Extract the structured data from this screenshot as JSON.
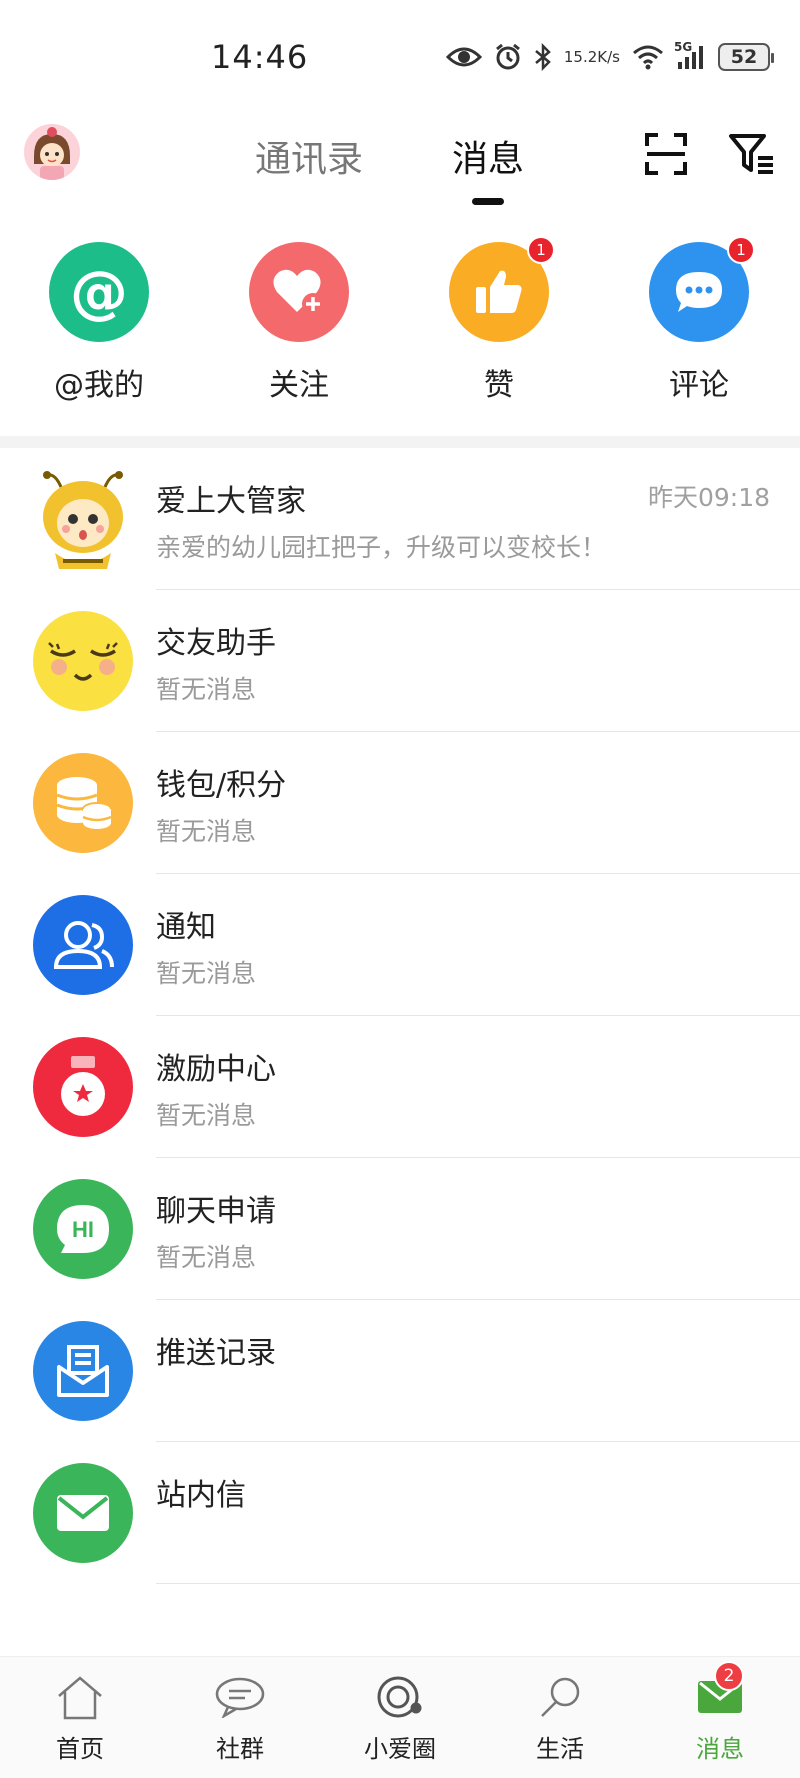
{
  "status_bar": {
    "time": "14:46",
    "net_speed_value": "15.2",
    "net_speed_unit": "K/s",
    "network": "5G",
    "battery": "52"
  },
  "header": {
    "tabs": [
      {
        "label": "通讯录",
        "active": false
      },
      {
        "label": "消息",
        "active": true
      }
    ]
  },
  "quick_actions": [
    {
      "label": "@我的",
      "icon": "at-icon",
      "color": "#1dbd8a",
      "badge": null
    },
    {
      "label": "关注",
      "icon": "heart-plus-icon",
      "color": "#f4696c",
      "badge": null
    },
    {
      "label": "赞",
      "icon": "thumbs-up-icon",
      "color": "#f9ac24",
      "badge": "1"
    },
    {
      "label": "评论",
      "icon": "chat-bubble-icon",
      "color": "#2d93ee",
      "badge": "1"
    }
  ],
  "messages": [
    {
      "title": "爱上大管家",
      "preview": "亲爱的幼儿园扛把子，升级可以变校长！",
      "time": "昨天09:18",
      "icon": "bee-mascot-icon"
    },
    {
      "title": "交友助手",
      "preview": "暂无消息",
      "time": "",
      "icon": "smiley-face-icon"
    },
    {
      "title": "钱包/积分",
      "preview": "暂无消息",
      "time": "",
      "icon": "coins-icon"
    },
    {
      "title": "通知",
      "preview": "暂无消息",
      "time": "",
      "icon": "users-icon"
    },
    {
      "title": "激励中心",
      "preview": "暂无消息",
      "time": "",
      "icon": "medal-icon"
    },
    {
      "title": "聊天申请",
      "preview": "暂无消息",
      "time": "",
      "icon": "hi-bubble-icon"
    },
    {
      "title": "推送记录",
      "preview": "",
      "time": "",
      "icon": "push-envelope-icon"
    },
    {
      "title": "站内信",
      "preview": "",
      "time": "",
      "icon": "mail-icon"
    }
  ],
  "tab_bar": [
    {
      "label": "首页",
      "icon": "home-icon",
      "active": false,
      "badge": null
    },
    {
      "label": "社群",
      "icon": "community-icon",
      "active": false,
      "badge": null
    },
    {
      "label": "小爱圈",
      "icon": "circle-icon",
      "active": false,
      "badge": null
    },
    {
      "label": "生活",
      "icon": "search-icon",
      "active": false,
      "badge": null
    },
    {
      "label": "消息",
      "icon": "message-icon",
      "active": true,
      "badge": "2"
    }
  ],
  "colors": {
    "accent_green": "#49a73b",
    "badge_red": "#e8232b"
  }
}
